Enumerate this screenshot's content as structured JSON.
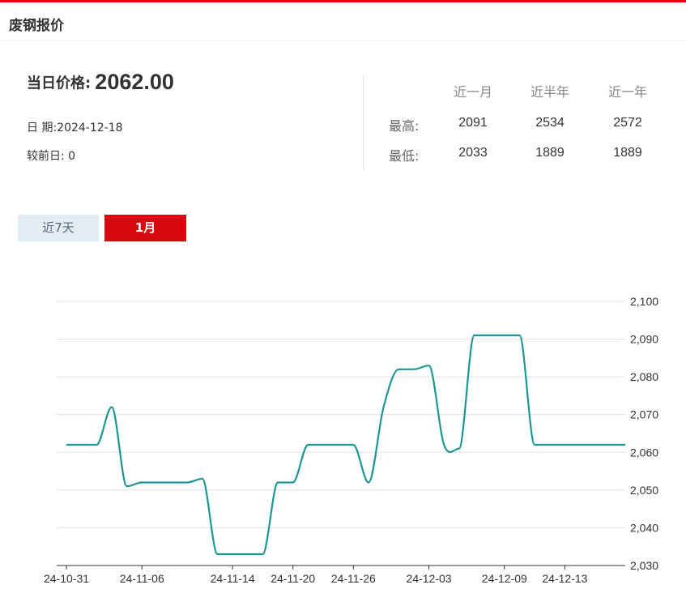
{
  "header": {
    "title": "废钢报价"
  },
  "summary": {
    "price_label": "当日价格:",
    "price_value": "2062.00",
    "date_label": "日 期:",
    "date_value": "2024-12-18",
    "change_label": "较前日:",
    "change_value": "0"
  },
  "stats": {
    "columns": [
      "近一月",
      "近半年",
      "近一年"
    ],
    "rows": [
      {
        "label": "最高:",
        "values": [
          "2091",
          "2534",
          "2572"
        ]
      },
      {
        "label": "最低:",
        "values": [
          "2033",
          "1889",
          "1889"
        ]
      }
    ]
  },
  "tabs": [
    {
      "label": "近7天",
      "active": false
    },
    {
      "label": "1月",
      "active": true
    }
  ],
  "colors": {
    "accent": "#d7080e",
    "line": "#1f9696",
    "tab_inactive_bg": "#e4ecf3"
  },
  "chart_data": {
    "type": "line",
    "x": [
      "24-10-31",
      "24-11-01",
      "24-11-02",
      "24-11-04",
      "24-11-05",
      "24-11-06",
      "24-11-07",
      "24-11-08",
      "24-11-11",
      "24-11-12",
      "24-11-13",
      "24-11-14",
      "24-11-15",
      "24-11-18",
      "24-11-19",
      "24-11-20",
      "24-11-21",
      "24-11-22",
      "24-11-25",
      "24-11-26",
      "24-11-27",
      "24-11-28",
      "24-11-29",
      "24-12-02",
      "24-12-03",
      "24-12-04",
      "24-12-05",
      "24-12-06",
      "24-12-07",
      "24-12-09",
      "24-12-10",
      "24-12-11",
      "24-12-12",
      "24-12-13",
      "24-12-14",
      "24-12-16",
      "24-12-17",
      "24-12-18"
    ],
    "series": [
      {
        "values": [
          2062,
          2062,
          2062,
          2072,
          2051,
          2052,
          2052,
          2052,
          2052,
          2053,
          2033,
          2033,
          2033,
          2033,
          2052,
          2052,
          2062,
          2062,
          2062,
          2062,
          2052,
          2072,
          2082,
          2082,
          2083,
          2062,
          2061,
          2091,
          2091,
          2091,
          2091,
          2062,
          2062,
          2062,
          2062,
          2062,
          2062,
          2062
        ]
      }
    ],
    "x_tick_labels": [
      "24-10-31",
      "24-11-06",
      "24-11-14",
      "24-11-20",
      "24-11-26",
      "24-12-03",
      "24-12-09",
      "24-12-13"
    ],
    "y_ticks": [
      2030,
      2040,
      2050,
      2060,
      2070,
      2080,
      2090,
      2100
    ],
    "y_tick_labels": [
      "2,030",
      "2,040",
      "2,050",
      "2,060",
      "2,070",
      "2,080",
      "2,090",
      "2,100"
    ],
    "ylim": [
      2030,
      2100
    ],
    "grid": true
  }
}
